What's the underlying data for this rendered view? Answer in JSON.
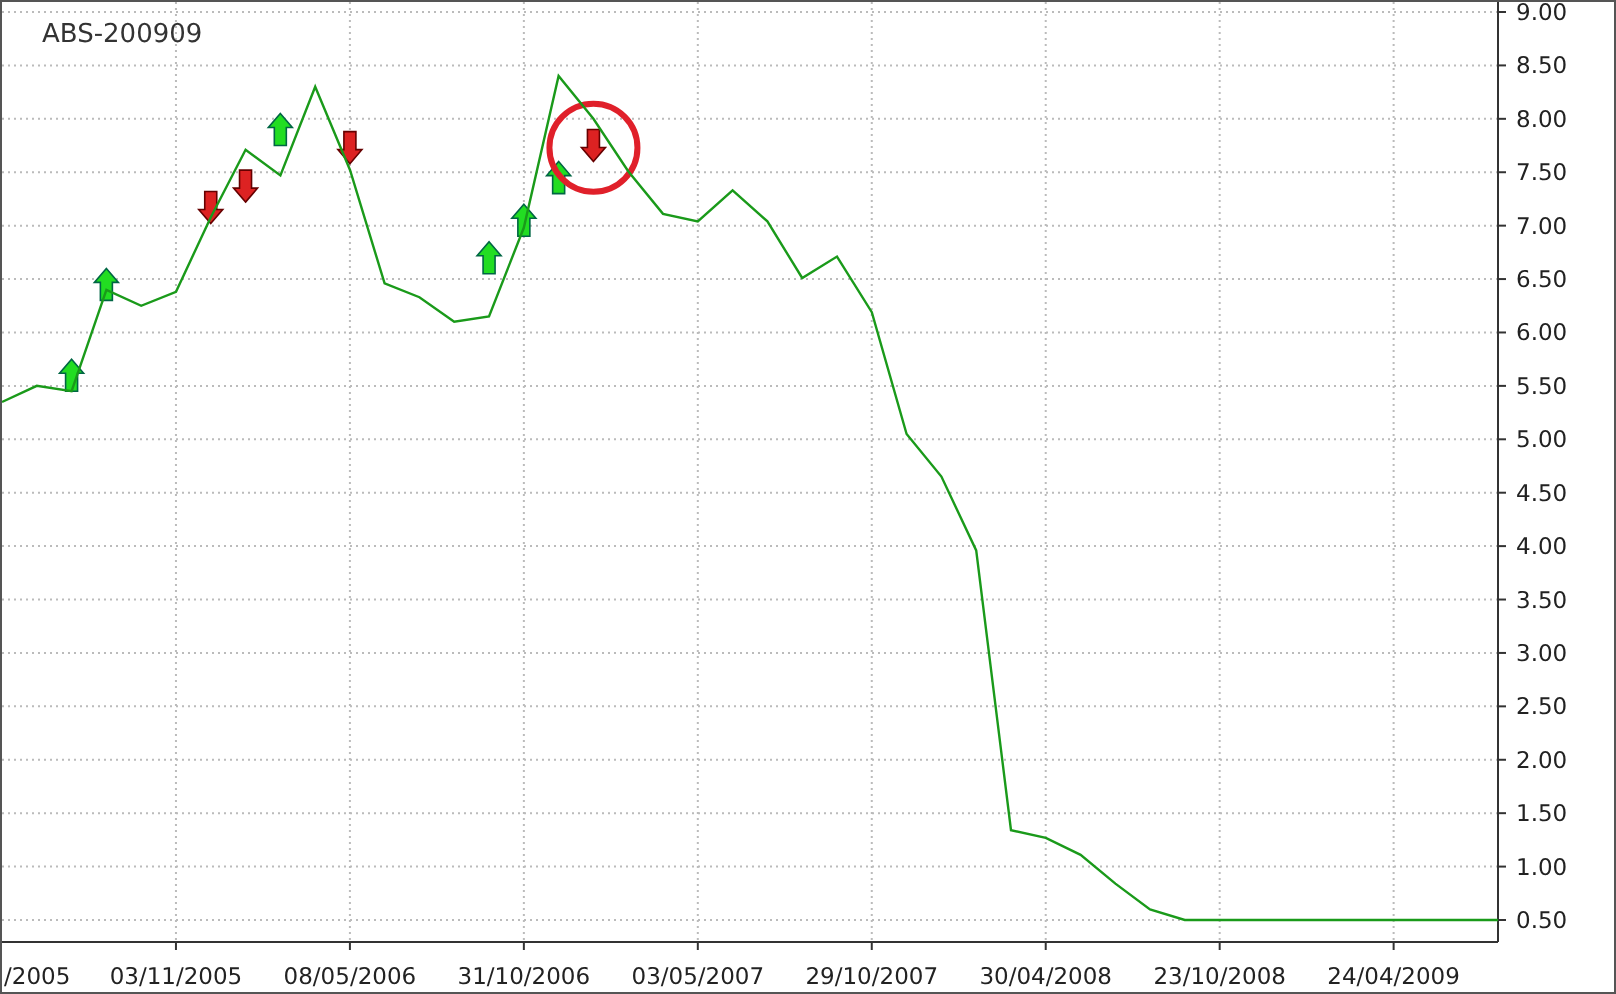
{
  "chart_data": {
    "type": "line",
    "title": "ABS-200909",
    "categories": [
      null,
      "/2005",
      null,
      null,
      null,
      "03/11/2005",
      null,
      null,
      null,
      null,
      "08/05/2006",
      null,
      null,
      null,
      null,
      "31/10/2006",
      null,
      null,
      null,
      null,
      "03/05/2007",
      null,
      null,
      null,
      null,
      "29/10/2007",
      null,
      null,
      null,
      null,
      "30/04/2008",
      null,
      null,
      null,
      null,
      "23/10/2008",
      null,
      null,
      null,
      null,
      "24/04/2009",
      null,
      null,
      null
    ],
    "grid": true,
    "series": [
      {
        "color": "#1a9a1a",
        "values": [
          5.35,
          5.5,
          5.45,
          6.4,
          6.25,
          6.38,
          7.08,
          7.71,
          7.47,
          8.3,
          7.52,
          6.46,
          6.33,
          6.1,
          6.15,
          6.98,
          8.4,
          8.0,
          7.51,
          7.11,
          7.04,
          7.33,
          7.04,
          6.51,
          6.71,
          6.19,
          5.05,
          4.65,
          3.96,
          1.34,
          1.27,
          1.11,
          0.84,
          0.6,
          0.5,
          0.5,
          0.5,
          0.5,
          0.5,
          0.5,
          0.5,
          0.5,
          0.5,
          0.5
        ]
      },
      {
        "type": "scatter",
        "color": "#22dd22",
        "values": [
          null,
          null,
          5.6,
          6.45,
          null,
          null,
          null,
          null,
          7.9,
          null,
          null,
          null,
          null,
          null,
          6.7,
          7.05,
          7.45,
          null,
          null,
          null,
          null,
          null,
          null,
          null,
          null,
          null,
          null,
          null,
          null,
          null,
          null,
          null,
          null,
          null,
          null,
          null,
          null,
          null,
          null,
          null,
          null,
          null,
          null,
          null
        ]
      },
      {
        "type": "scatter",
        "color": "#dd2222",
        "values": [
          null,
          null,
          null,
          null,
          null,
          null,
          7.17,
          7.37,
          null,
          null,
          7.73,
          null,
          null,
          null,
          null,
          null,
          null,
          7.75,
          null,
          null,
          null,
          null,
          null,
          null,
          null,
          null,
          null,
          null,
          null,
          null,
          null,
          null,
          null,
          null,
          null,
          null,
          null,
          null,
          null,
          null,
          null,
          null,
          null,
          null
        ]
      },
      {
        "type": "scatter",
        "color": "#e0202a",
        "values": [
          null,
          null,
          null,
          null,
          null,
          null,
          null,
          null,
          null,
          null,
          null,
          null,
          null,
          null,
          null,
          null,
          null,
          7.73,
          null,
          null,
          null,
          null,
          null,
          null,
          null,
          null,
          null,
          null,
          null,
          null,
          null,
          null,
          null,
          null,
          null,
          null,
          null,
          null,
          null,
          null,
          null,
          null,
          null,
          null
        ]
      }
    ],
    "ylim": [
      0.5,
      9.0
    ],
    "yticks": [
      {
        "value": 0.5,
        "label": "0.50"
      },
      {
        "value": 1,
        "label": "1.00"
      },
      {
        "value": 1.5,
        "label": "1.50"
      },
      {
        "value": 2,
        "label": "2.00"
      },
      {
        "value": 2.5,
        "label": "2.50"
      },
      {
        "value": 3,
        "label": "3.00"
      },
      {
        "value": 3.5,
        "label": "3.50"
      },
      {
        "value": 4,
        "label": "4.00"
      },
      {
        "value": 4.5,
        "label": "4.50"
      },
      {
        "value": 5,
        "label": "5.00"
      },
      {
        "value": 5.5,
        "label": "5.50"
      },
      {
        "value": 6,
        "label": "6.00"
      },
      {
        "value": 6.5,
        "label": "6.50"
      },
      {
        "value": 7,
        "label": "7.00"
      },
      {
        "value": 7.5,
        "label": "7.50"
      },
      {
        "value": 8,
        "label": "8.00"
      },
      {
        "value": 8.5,
        "label": "8.50"
      },
      {
        "value": 9,
        "label": "9.00"
      }
    ]
  }
}
